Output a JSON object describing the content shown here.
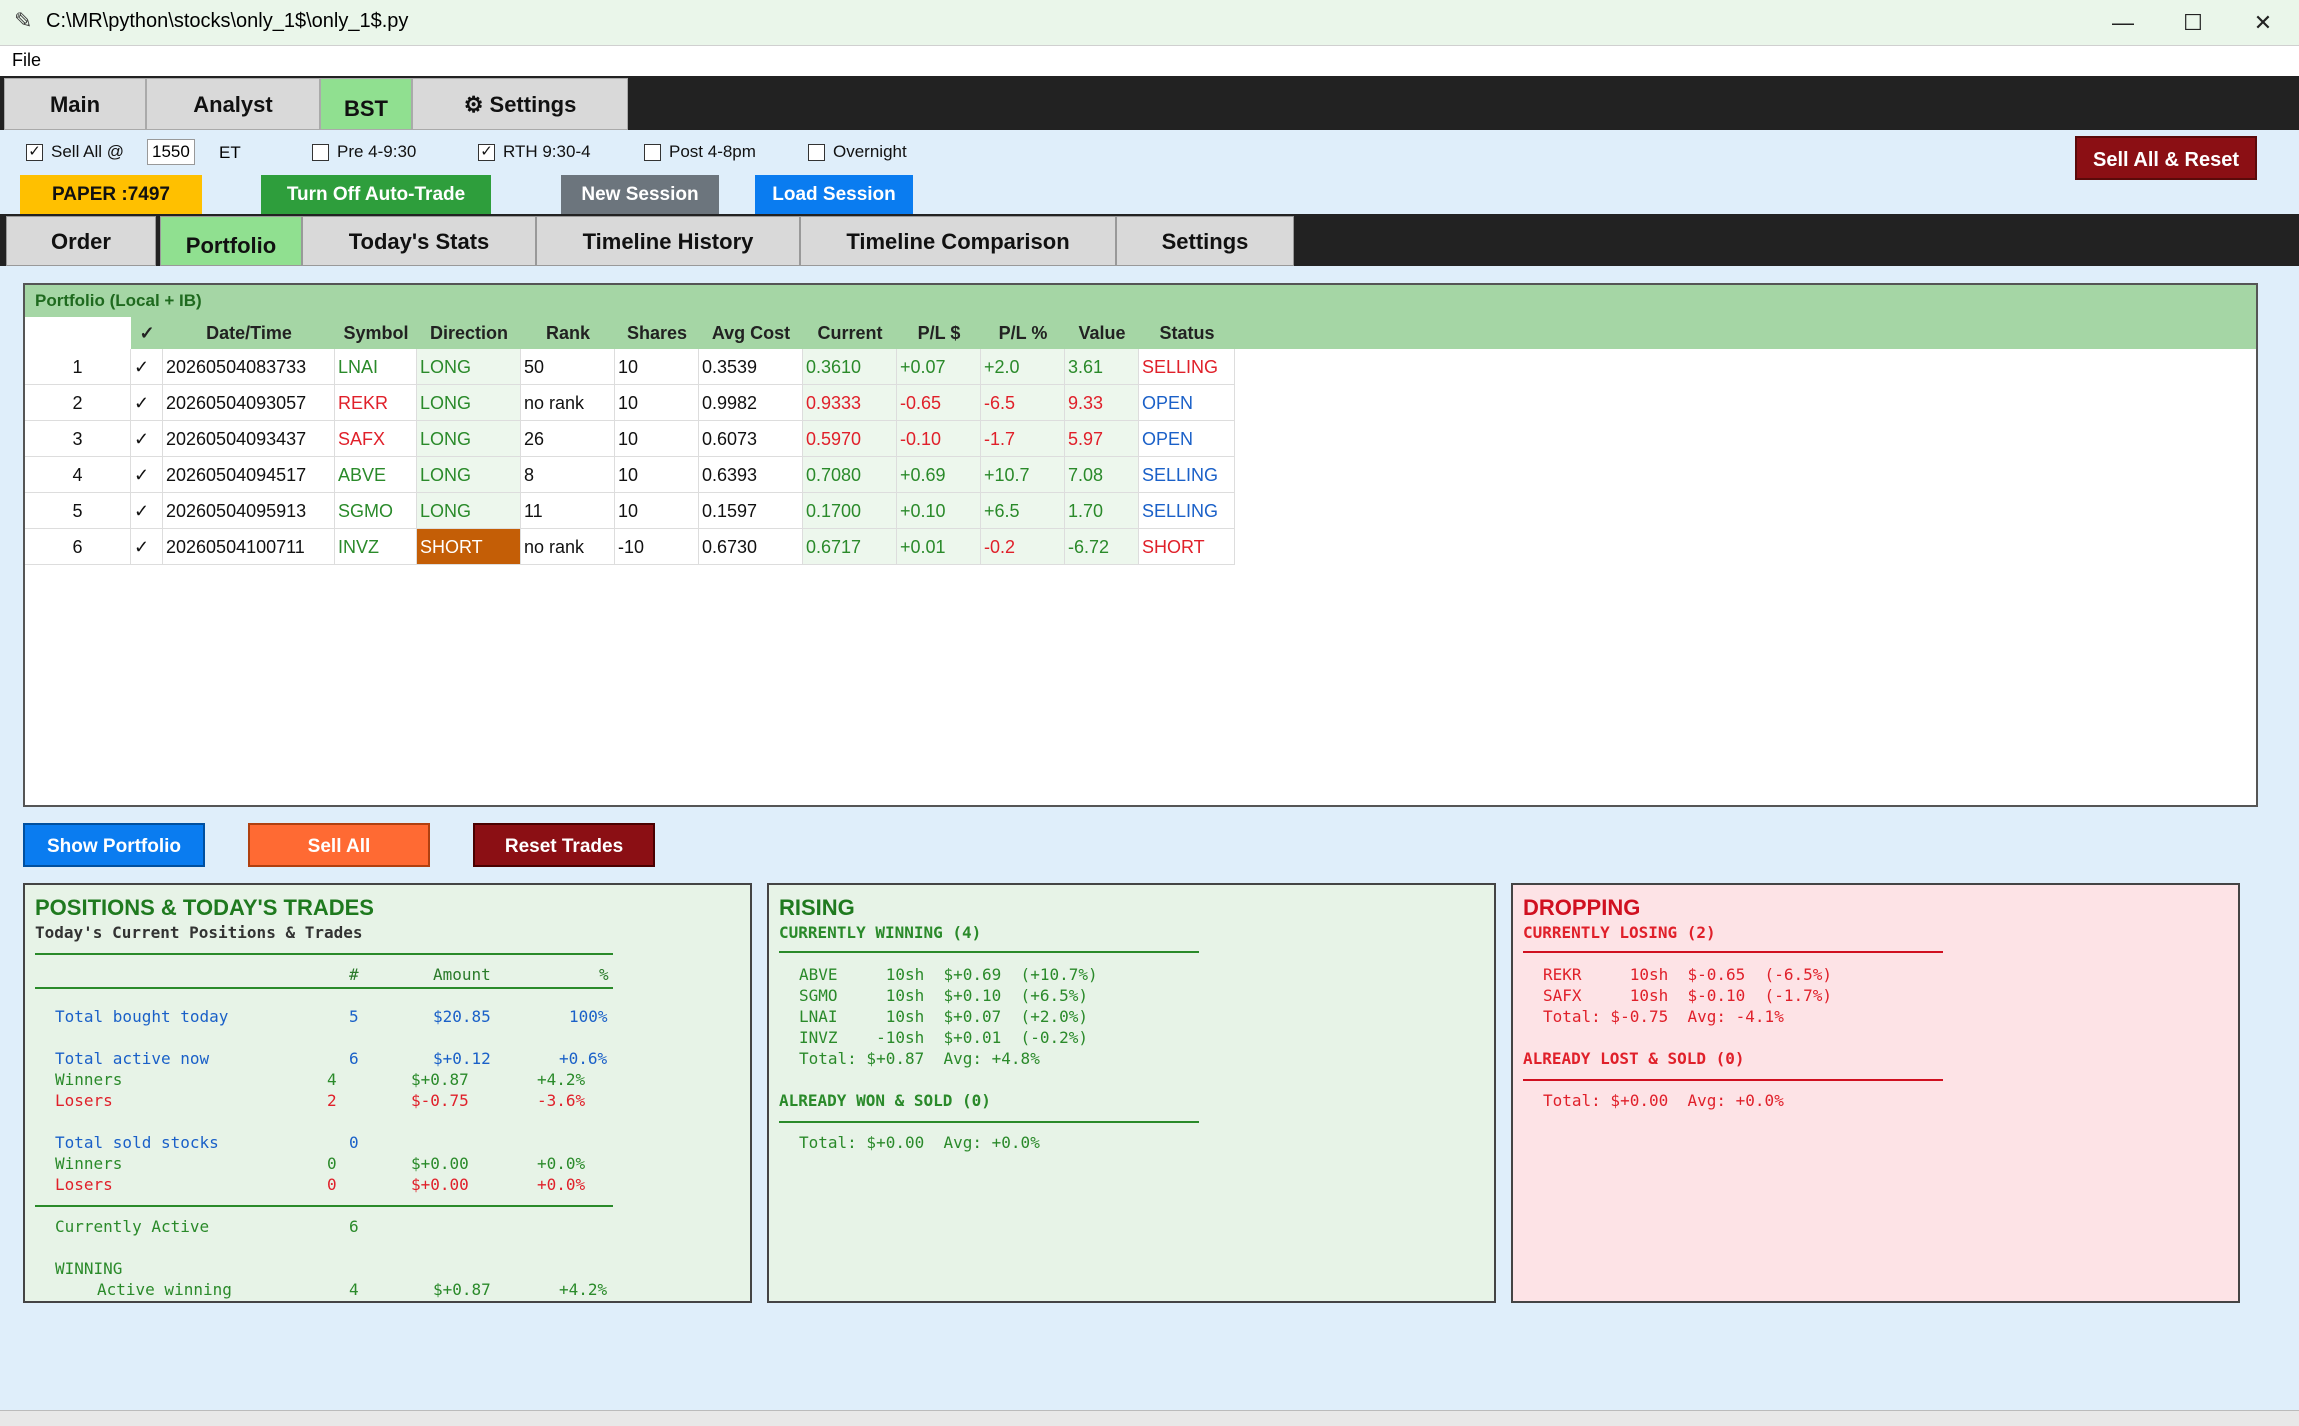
{
  "window": {
    "title": "C:\\MR\\python\\stocks\\only_1$\\only_1$.py",
    "minimize": "—",
    "maximize": "☐",
    "close": "✕",
    "icon": "feather-icon"
  },
  "menu": {
    "file": "File"
  },
  "top_tabs": [
    {
      "label": "Main"
    },
    {
      "label": "Analyst"
    },
    {
      "label": "BST"
    },
    {
      "label": "⚙ Settings"
    }
  ],
  "controls": {
    "sell_all_label": "Sell All @",
    "sell_all_time": "1550",
    "et": "ET",
    "pre": "Pre 4-9:30",
    "rth": "RTH 9:30-4",
    "post": "Post 4-8pm",
    "overnight": "Overnight",
    "sell_all_reset": "Sell All & Reset",
    "paper": "PAPER :7497",
    "auto_trade": "Turn Off Auto-Trade",
    "new_session": "New Session",
    "load_session": "Load Session"
  },
  "inner_tabs": [
    {
      "label": "Order"
    },
    {
      "label": "Portfolio"
    },
    {
      "label": "Today's Stats"
    },
    {
      "label": "Timeline History"
    },
    {
      "label": "Timeline Comparison"
    },
    {
      "label": "Settings"
    }
  ],
  "portfolio": {
    "label": "Portfolio (Local + IB)",
    "headers": [
      "✓",
      "Date/Time",
      "Symbol",
      "Direction",
      "Rank",
      "Shares",
      "Avg Cost",
      "Current",
      "P/L $",
      "P/L %",
      "Value",
      "Status"
    ],
    "rows": [
      {
        "n": "1",
        "chk": "✓",
        "dt": "20260504083733",
        "sym": "LNAI",
        "dir": "LONG",
        "rank": "50",
        "sh": "10",
        "avg": "0.3539",
        "cur": "0.3610",
        "pl": "+0.07",
        "plp": "+2.0",
        "val": "3.61",
        "status": "SELLING"
      },
      {
        "n": "2",
        "chk": "✓",
        "dt": "20260504093057",
        "sym": "REKR",
        "dir": "LONG",
        "rank": "no rank",
        "sh": "10",
        "avg": "0.9982",
        "cur": "0.9333",
        "pl": "-0.65",
        "plp": "-6.5",
        "val": "9.33",
        "status": "OPEN"
      },
      {
        "n": "3",
        "chk": "✓",
        "dt": "20260504093437",
        "sym": "SAFX",
        "dir": "LONG",
        "rank": "26",
        "sh": "10",
        "avg": "0.6073",
        "cur": "0.5970",
        "pl": "-0.10",
        "plp": "-1.7",
        "val": "5.97",
        "status": "OPEN"
      },
      {
        "n": "4",
        "chk": "✓",
        "dt": "20260504094517",
        "sym": "ABVE",
        "dir": "LONG",
        "rank": "8",
        "sh": "10",
        "avg": "0.6393",
        "cur": "0.7080",
        "pl": "+0.69",
        "plp": "+10.7",
        "val": "7.08",
        "status": "SELLING"
      },
      {
        "n": "5",
        "chk": "✓",
        "dt": "20260504095913",
        "sym": "SGMO",
        "dir": "LONG",
        "rank": "11",
        "sh": "10",
        "avg": "0.1597",
        "cur": "0.1700",
        "pl": "+0.10",
        "plp": "+6.5",
        "val": "1.70",
        "status": "SELLING"
      },
      {
        "n": "6",
        "chk": "✓",
        "dt": "20260504100711",
        "sym": "INVZ",
        "dir": "SHORT",
        "rank": "no rank",
        "sh": "-10",
        "avg": "0.6730",
        "cur": "0.6717",
        "pl": "+0.01",
        "plp": "-0.2",
        "val": "-6.72",
        "status": "SHORT"
      }
    ]
  },
  "actions": {
    "show_portfolio": "Show Portfolio",
    "sell_all": "Sell All",
    "reset_trades": "Reset Trades"
  },
  "positions": {
    "title": "POSITIONS & TODAY'S TRADES",
    "subtitle": "Today's Current Positions & Trades",
    "col_hash": "#",
    "col_amount": "Amount",
    "col_pct": "%",
    "bought_label": "Total bought today",
    "bought_n": "5",
    "bought_amt": "$20.85",
    "bought_pct": "100%",
    "active_label": "Total active now",
    "active_n": "6",
    "active_amt": "$+0.12",
    "active_pct": "+0.6%",
    "aw_label": "Winners",
    "aw_n": "4",
    "aw_amt": "$+0.87",
    "aw_pct": "+4.2%",
    "al_label": "Losers",
    "al_n": "2",
    "al_amt": "$-0.75",
    "al_pct": "-3.6%",
    "sold_label": "Total sold stocks",
    "sold_n": "0",
    "sw_label": "Winners",
    "sw_n": "0",
    "sw_amt": "$+0.00",
    "sw_pct": "+0.0%",
    "sl_label": "Losers",
    "sl_n": "0",
    "sl_amt": "$+0.00",
    "sl_pct": "+0.0%",
    "ca_label": "Currently Active",
    "ca_n": "6",
    "winning_label": "WINNING",
    "actw_label": "Active winning",
    "actw_n": "4",
    "actw_amt": "$+0.87",
    "actw_pct": "+4.2%"
  },
  "rising": {
    "title": "RISING",
    "sub1": "CURRENTLY WINNING (4)",
    "lines": [
      "ABVE     10sh  $+0.69  (+10.7%)",
      "SGMO     10sh  $+0.10  (+6.5%)",
      "LNAI     10sh  $+0.07  (+2.0%)",
      "INVZ    -10sh  $+0.01  (-0.2%)",
      "Total: $+0.87  Avg: +4.8%"
    ],
    "sub2": "ALREADY WON & SOLD (0)",
    "total2": "Total: $+0.00  Avg: +0.0%"
  },
  "dropping": {
    "title": "DROPPING",
    "sub1": "CURRENTLY LOSING (2)",
    "lines": [
      "REKR     10sh  $-0.65  (-6.5%)",
      "SAFX     10sh  $-0.10  (-1.7%)",
      "Total: $-0.75  Avg: -4.1%"
    ],
    "sub2": "ALREADY LOST & SOLD (0)",
    "total2": "Total: $+0.00  Avg: +0.0%"
  }
}
